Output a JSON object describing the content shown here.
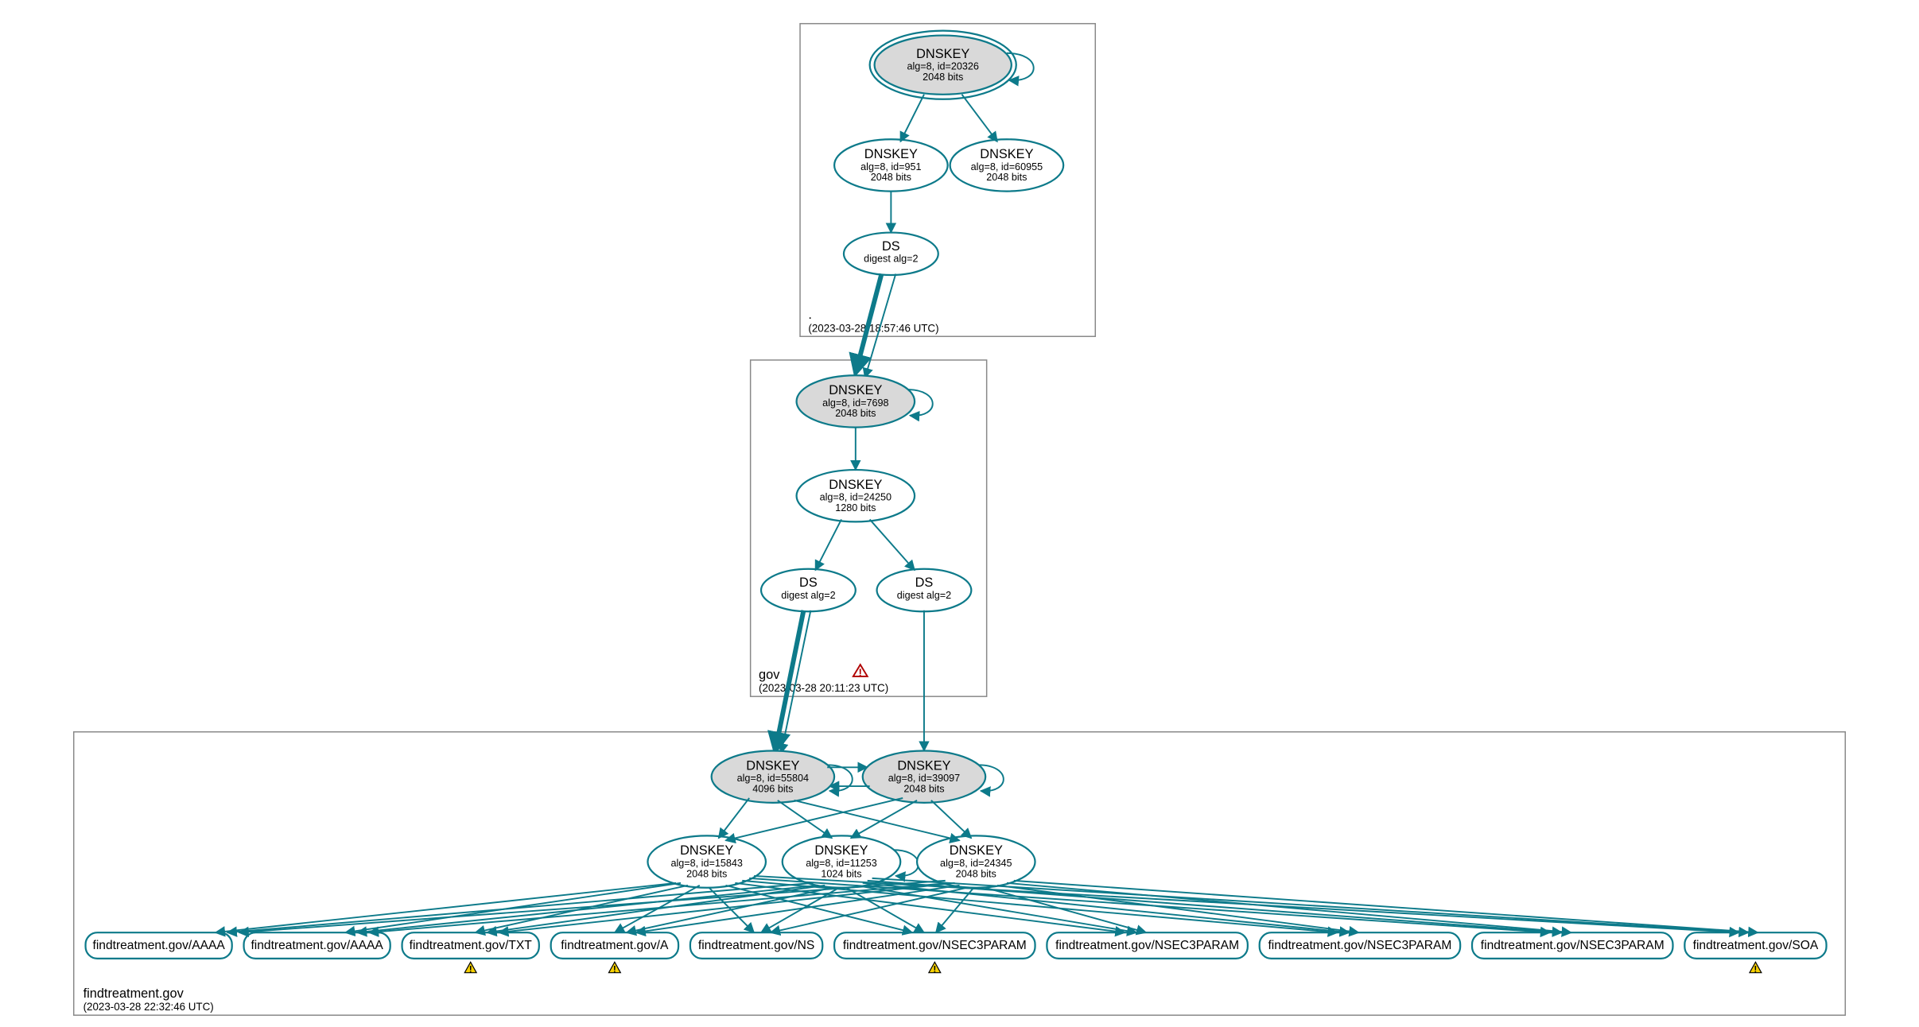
{
  "zones": {
    "root": {
      "label": ".",
      "timestamp": "(2023-03-28 18:57:46 UTC)"
    },
    "gov": {
      "label": "gov",
      "timestamp": "(2023-03-28 20:11:23 UTC)"
    },
    "findtreatment": {
      "label": "findtreatment.gov",
      "timestamp": "(2023-03-28 22:32:46 UTC)"
    }
  },
  "nodes": {
    "root_ksk": {
      "title": "DNSKEY",
      "line1": "alg=8, id=20326",
      "line2": "2048 bits"
    },
    "root_zsk1": {
      "title": "DNSKEY",
      "line1": "alg=8, id=951",
      "line2": "2048 bits"
    },
    "root_zsk2": {
      "title": "DNSKEY",
      "line1": "alg=8, id=60955",
      "line2": "2048 bits"
    },
    "root_ds": {
      "title": "DS",
      "line1": "digest alg=2",
      "line2": ""
    },
    "gov_ksk": {
      "title": "DNSKEY",
      "line1": "alg=8, id=7698",
      "line2": "2048 bits"
    },
    "gov_zsk": {
      "title": "DNSKEY",
      "line1": "alg=8, id=24250",
      "line2": "1280 bits"
    },
    "gov_ds1": {
      "title": "DS",
      "line1": "digest alg=2",
      "line2": ""
    },
    "gov_ds2": {
      "title": "DS",
      "line1": "digest alg=2",
      "line2": ""
    },
    "ft_ksk1": {
      "title": "DNSKEY",
      "line1": "alg=8, id=55804",
      "line2": "4096 bits"
    },
    "ft_ksk2": {
      "title": "DNSKEY",
      "line1": "alg=8, id=39097",
      "line2": "2048 bits"
    },
    "ft_zsk1": {
      "title": "DNSKEY",
      "line1": "alg=8, id=15843",
      "line2": "2048 bits"
    },
    "ft_zsk2": {
      "title": "DNSKEY",
      "line1": "alg=8, id=11253",
      "line2": "1024 bits"
    },
    "ft_zsk3": {
      "title": "DNSKEY",
      "line1": "alg=8, id=24345",
      "line2": "2048 bits"
    }
  },
  "rrsets": {
    "aaaa1": {
      "text": "findtreatment.gov/AAAA"
    },
    "aaaa2": {
      "text": "findtreatment.gov/AAAA"
    },
    "txt": {
      "text": "findtreatment.gov/TXT",
      "warn": true
    },
    "a": {
      "text": "findtreatment.gov/A",
      "warn": true
    },
    "ns": {
      "text": "findtreatment.gov/NS"
    },
    "n3p1": {
      "text": "findtreatment.gov/NSEC3PARAM",
      "warn": true
    },
    "n3p2": {
      "text": "findtreatment.gov/NSEC3PARAM"
    },
    "n3p3": {
      "text": "findtreatment.gov/NSEC3PARAM"
    },
    "n3p4": {
      "text": "findtreatment.gov/NSEC3PARAM"
    },
    "soa": {
      "text": "findtreatment.gov/SOA",
      "warn": true
    }
  },
  "colors": {
    "teal": "#0d7a8a"
  }
}
